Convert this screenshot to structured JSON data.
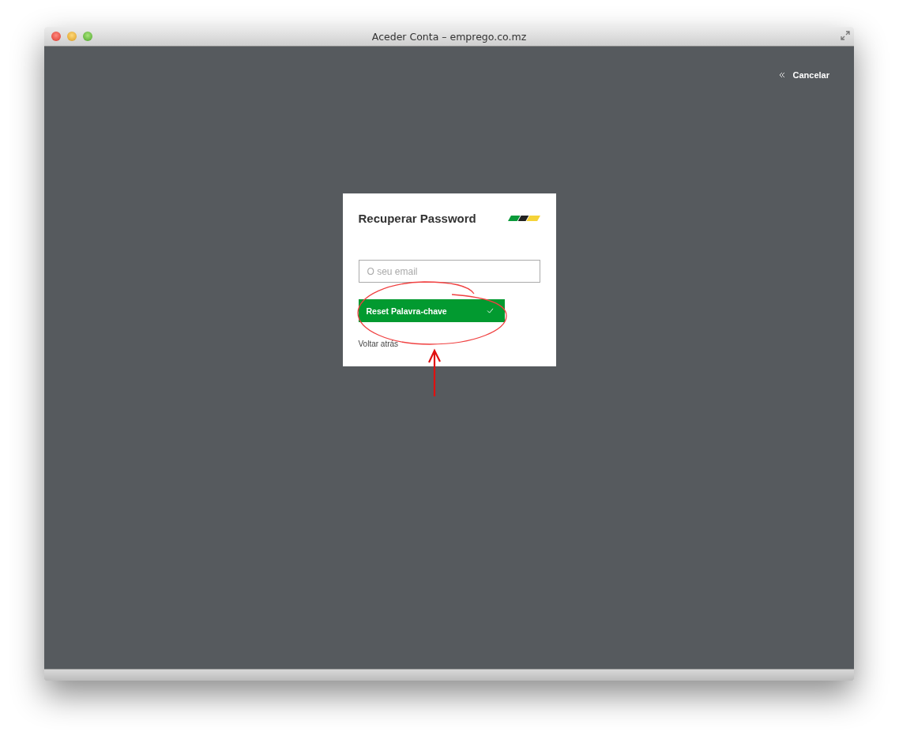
{
  "window": {
    "title": "Aceder Conta – emprego.co.mz"
  },
  "cancel_link": {
    "label": "Cancelar"
  },
  "card": {
    "title": "Recuperar Password",
    "email_field": {
      "placeholder": "O seu email"
    },
    "reset_button": {
      "label": "Reset Palavra-chave"
    },
    "back_link": {
      "label": "Voltar atrás"
    }
  }
}
